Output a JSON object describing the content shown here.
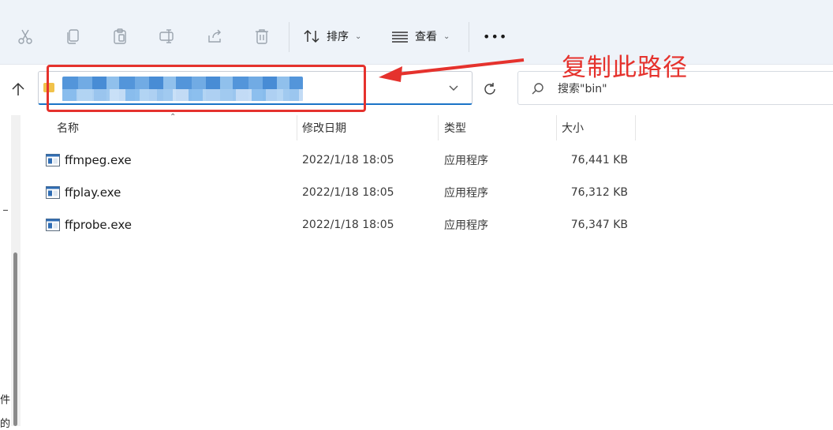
{
  "toolbar": {
    "icons": [
      "cut-icon",
      "copy-icon",
      "paste-icon",
      "rename-icon",
      "share-icon",
      "delete-icon"
    ],
    "sort_label": "排序",
    "view_label": "查看",
    "more_label": "•••"
  },
  "address": {
    "search_placeholder": "搜索\"bin\""
  },
  "annotation": {
    "text": "复制此路径",
    "color": "#e5322d"
  },
  "columns": {
    "name": "名称",
    "date": "修改日期",
    "type": "类型",
    "size": "大小"
  },
  "files": [
    {
      "name": "ffmpeg.exe",
      "date": "2022/1/18 18:05",
      "type": "应用程序",
      "size": "76,441 KB"
    },
    {
      "name": "ffplay.exe",
      "date": "2022/1/18 18:05",
      "type": "应用程序",
      "size": "76,312 KB"
    },
    {
      "name": "ffprobe.exe",
      "date": "2022/1/18 18:05",
      "type": "应用程序",
      "size": "76,347 KB"
    }
  ],
  "edge_fragments": [
    "件",
    "的"
  ],
  "colors": {
    "accent": "#1a73c7",
    "toolbar_bg": "#eef3f9",
    "annotation": "#e5322d"
  }
}
